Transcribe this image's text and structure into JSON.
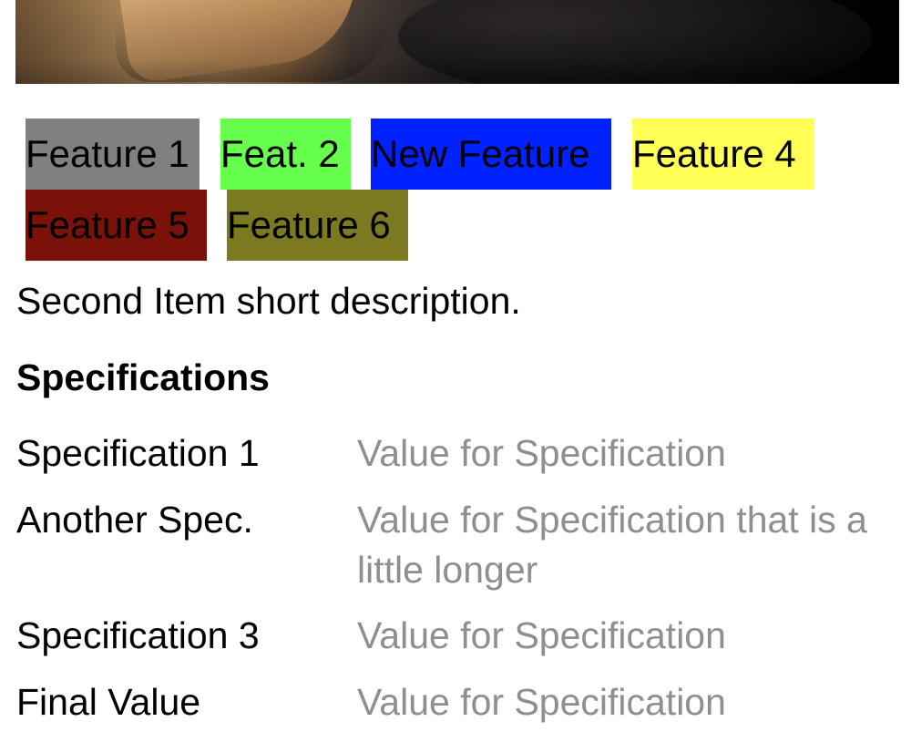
{
  "hero_image": {
    "description_icon": "product-photo"
  },
  "features": [
    {
      "label": "Feature 1",
      "color": "#808080"
    },
    {
      "label": "Feat. 2",
      "color": "#66ff4d"
    },
    {
      "label": "New Feature",
      "color": "#0022ff"
    },
    {
      "label": "Feature 4",
      "color": "#ffff55"
    },
    {
      "label": "Feature 5",
      "color": "#7a1209"
    },
    {
      "label": "Feature 6",
      "color": "#7c7a20"
    }
  ],
  "description": "Second Item short description.",
  "specifications": {
    "heading": "Specifications",
    "rows": [
      {
        "name": "Specification 1",
        "value": "Value for Specification"
      },
      {
        "name": "Another Spec.",
        "value": "Value for Specification that is a little longer"
      },
      {
        "name": "Specification 3",
        "value": "Value for Specification"
      },
      {
        "name": "Final Value",
        "value": "Value for Specification"
      }
    ]
  },
  "colors": {
    "value_text": "#8e8e93",
    "primary_text": "#000000",
    "background": "#ffffff"
  }
}
